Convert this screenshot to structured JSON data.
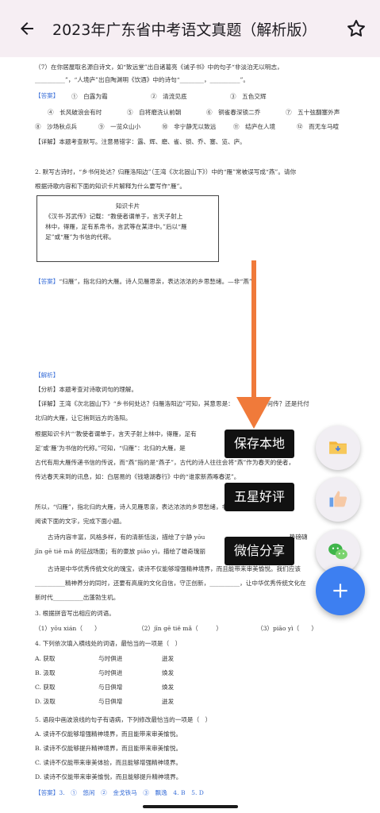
{
  "header": {
    "title": "2023年广东省中考语文真题（解析版）",
    "back_icon": "arrow-left-icon",
    "favorite_icon": "star-outline-icon"
  },
  "document": {
    "q7_line1": "（7）在你居屋取名源自诗文，如“致远堂”出自诸葛亮《诫子书》中的句子“非淡泊无以明志，",
    "q7_line2": "__________”，“人境庐”出自陶渊明《饮酒》中的诗句“________，__________”。",
    "answer_tag": "【答案】",
    "answers_row1": [
      "①　白露为霜",
      "②　清流见底",
      "③　五色交辉"
    ],
    "answers_row2": [
      "④　长风破浪会有时",
      "⑤　自将磨洗认前朝",
      "⑥　铜雀春深锁二乔",
      "⑦　五十弦翻塞外声"
    ],
    "answers_row3": [
      "⑧　沙场秋点兵",
      "⑨　一览众山小",
      "⑩　非宁静无以致远",
      "⑪　结庐在人境",
      "⑫　而无车马喧"
    ],
    "detail1": "【详解】本题考查默写。注意易错字：露、辉、磨、雀、锁、乔、塞、览、庐。",
    "q2_line1": "2. 默写古诗时，“乡书何处达？归雁洛阳边”（王湾《次北固山下》）中的“雁”常被误写成“燕”。请你",
    "q2_line2": "根据诗歌内容和下面的知识卡片解释为什么要写作“雁”。",
    "card_title": "知识卡片",
    "card_line1": "《汉书·苏武传》记载：“教使者谓单于，言天子射上",
    "card_line2": "林中，得雁，足有系帛书，言武等在某泽中。”后以“雁",
    "card_line3": "足”或“雁”为书信的代称。",
    "answer2": "“归雁”，指北归的大雁。诗人见雁思亲，表达浓浓的乡思愁绪。—非“燕”。",
    "analysis_tag": "【解析】",
    "analysis_line": "【分析】本题考查对诗歌词句的理解。",
    "detail2_1": "【详解】王湾《次北固山下》“乡书何处达？归雁洛阳边”可知，其意思是：　　　，家信何传？还是托付",
    "detail2_2": "北归的大雁，让它捎到远方的洛阳。",
    "detail2_3": "根据知识卡片“‘教使者谓单于，言天子射上林中，得雁，足有　　　　　　　　　’后以‘雁",
    "detail2_4": "足’或‘雁’为书信的代称。”可知，“归雁”：北归的大雁，是　　　　　　　　　。大雁在",
    "detail2_5": "古代有用大雁传递书信的传说，而“燕”指的是“燕子”，古代的诗人往往会将“燕”作为春天的使者，",
    "detail2_6": "传达春天来到的讯息，如：白居易的《钱塘湖春行》中的“谁家新燕啄春泥”。",
    "conclusion": "所以，“归雁”，指北归的大雁，诗人见雁思亲，表达浓浓的乡思愁绪，非“　　”。",
    "read_line": "阅读下面的文字，完成下面小题。",
    "passage1": "古诗内容丰富，风格多样，有的清新恬淡，描绘了宁静 yōu　　　　　　　　　　　　　　势磅礴",
    "passage2": "jīn gē tiě mǎ 的征战场面；有的豪放 piāo yì，描绘了雄奇瑰丽",
    "passage3": "古诗是中华优秀传统文化的瑰宝，读诗不仅能够增强精神境界，而且能带来审美愉悦。我们应该",
    "passage4": "__________精神养分的同时，还要有高度的文化自信，守正创新，__________，让中华优秀传统文化在",
    "passage5": "新时代__________出蓬勃生机。",
    "q3": "3. 根据拼音写出相应的词语。",
    "q3_opts": [
      "（1）yōu xián（　　）",
      "（2）jīn gē tiě mǎ（　　　）",
      "（3）piāo yì（　　）"
    ],
    "q4": "4. 下列依次填入横线处的词语，最恰当的一项是（　）",
    "q4_opts": [
      [
        "A. 获取",
        "与时俱进",
        "迸发"
      ],
      [
        "B. 汲取",
        "与时俱进",
        "焕发"
      ],
      [
        "C. 获取",
        "与日俱增",
        "焕发"
      ],
      [
        "D. 汲取",
        "与日俱增",
        "迸发"
      ]
    ],
    "q5": "5. 语段中画波浪线的句子有语病，下列修改最恰当的一项是（　）",
    "q5_opts": [
      "A. 读诗不仅能够增强精神境界，而且能带来审美愉悦。",
      "B. 读诗不仅能够提升精神境界，而且能带来审美愉悦。",
      "C. 读诗不仅能带来审美体验，而且能够增强精神境界。",
      "D. 读诗不仅能带来审美愉悦，而且能够提升精神境界。"
    ],
    "final_answer": "【答案】3.　①　悠闲　②　金戈铁马　③　飘逸　4. B　5. D"
  },
  "menu": {
    "save_label": "保存本地",
    "rate_label": "五星好评",
    "share_label": "微信分享",
    "save_icon": "folder-download-icon",
    "rate_icon": "thumbs-up-icon",
    "share_icon": "wechat-icon",
    "main_icon": "plus-icon"
  },
  "colors": {
    "accent": "#3d7ff1",
    "arrow": "#f07a3a",
    "topbar": "#f6eef3",
    "answer_blue": "#3a6fd8"
  }
}
